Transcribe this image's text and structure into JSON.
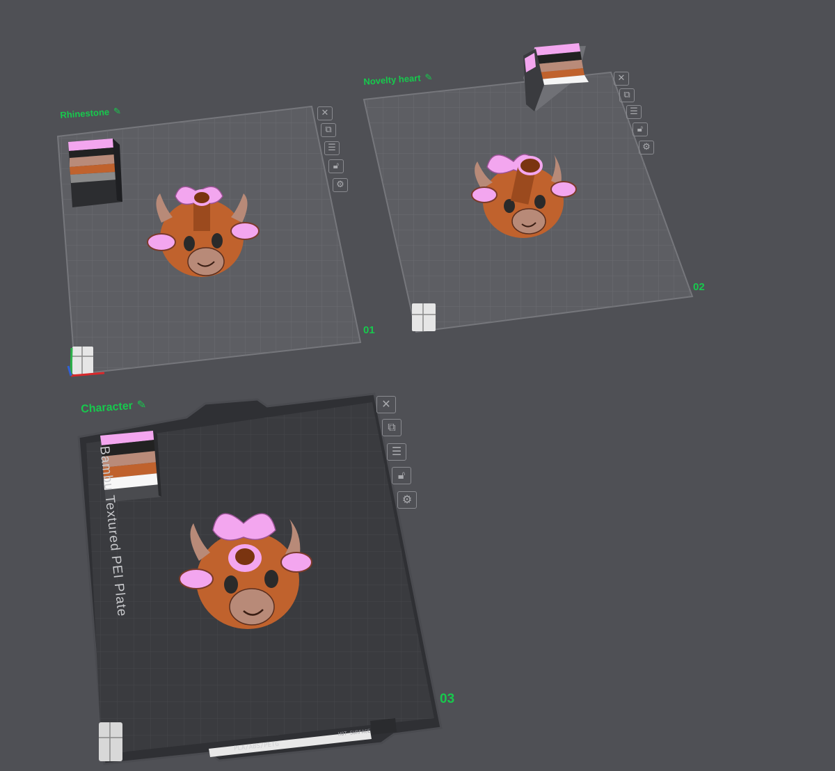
{
  "plates": [
    {
      "name": "Rhinestone",
      "number": "01"
    },
    {
      "name": "Novelty heart",
      "number": "02"
    },
    {
      "name": "Character",
      "number": "03"
    }
  ],
  "edit_icon": "pencil-icon",
  "toolbar_icons": [
    "close-icon",
    "arrange-icon",
    "layout-icon",
    "lock-icon",
    "settings-icon"
  ],
  "plate_type_text": "Bambu Textured PEI Plate",
  "filament_text": "PLA/ABS/PETG",
  "hot_surface_text": "HOT SURFACE",
  "colors": {
    "background": "#4f5055",
    "label_green": "#17c94d",
    "bow_pink": "#f3a6ef",
    "cow_brown": "#c0622d",
    "horn_tan": "#b88a78"
  }
}
